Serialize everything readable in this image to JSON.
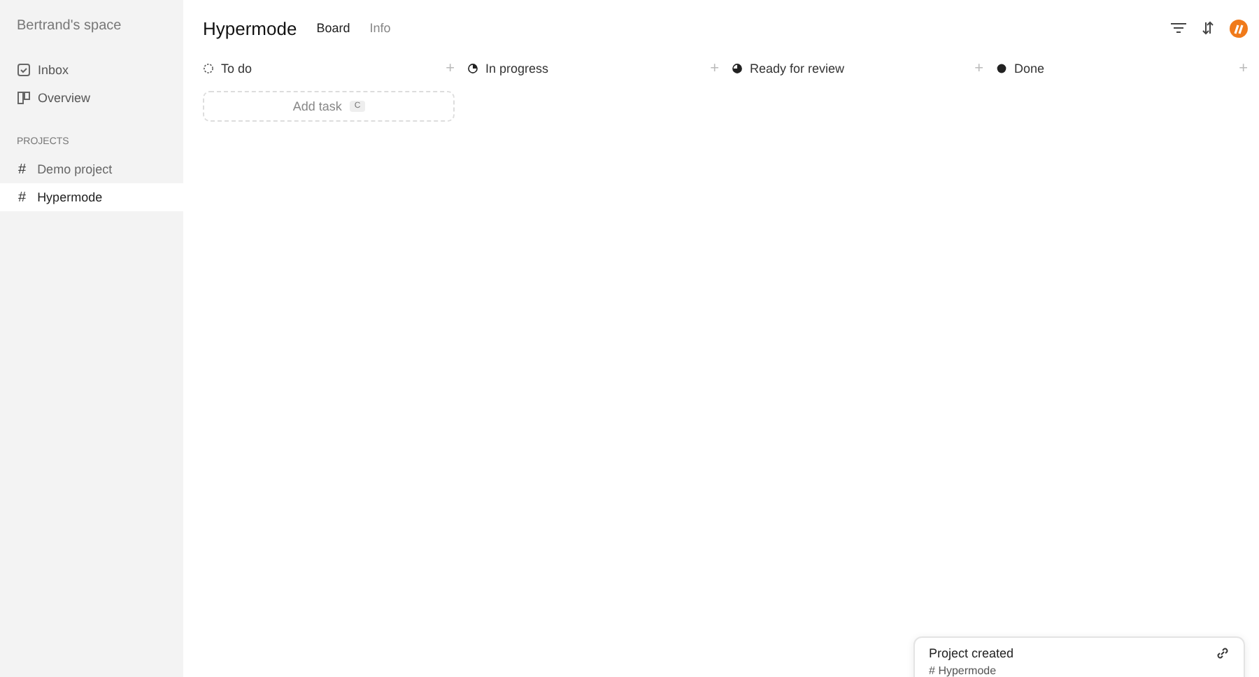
{
  "sidebar": {
    "workspace": "Bertrand's space",
    "nav": [
      {
        "label": "Inbox",
        "kind": "inbox"
      },
      {
        "label": "Overview",
        "kind": "overview"
      }
    ],
    "section": "PROJECTS",
    "projects": [
      {
        "icon": "#",
        "label": "Demo project",
        "selected": false
      },
      {
        "icon": "#",
        "label": "Hypermode",
        "selected": true
      }
    ]
  },
  "header": {
    "title": "Hypermode",
    "tabs": [
      {
        "label": "Board",
        "selected": true
      },
      {
        "label": "Info",
        "selected": false
      }
    ]
  },
  "columns": [
    {
      "title": "To do",
      "kind": "todo",
      "add": "+",
      "add_task": {
        "label": "Add task",
        "shortcut": "C"
      }
    },
    {
      "title": "In progress",
      "kind": "progress",
      "add": "+"
    },
    {
      "title": "Ready for review",
      "kind": "review",
      "add": "+"
    },
    {
      "title": "Done",
      "kind": "done",
      "add": "+"
    }
  ],
  "toast": {
    "title": "Project created",
    "icon": "#",
    "project": "Hypermode"
  }
}
